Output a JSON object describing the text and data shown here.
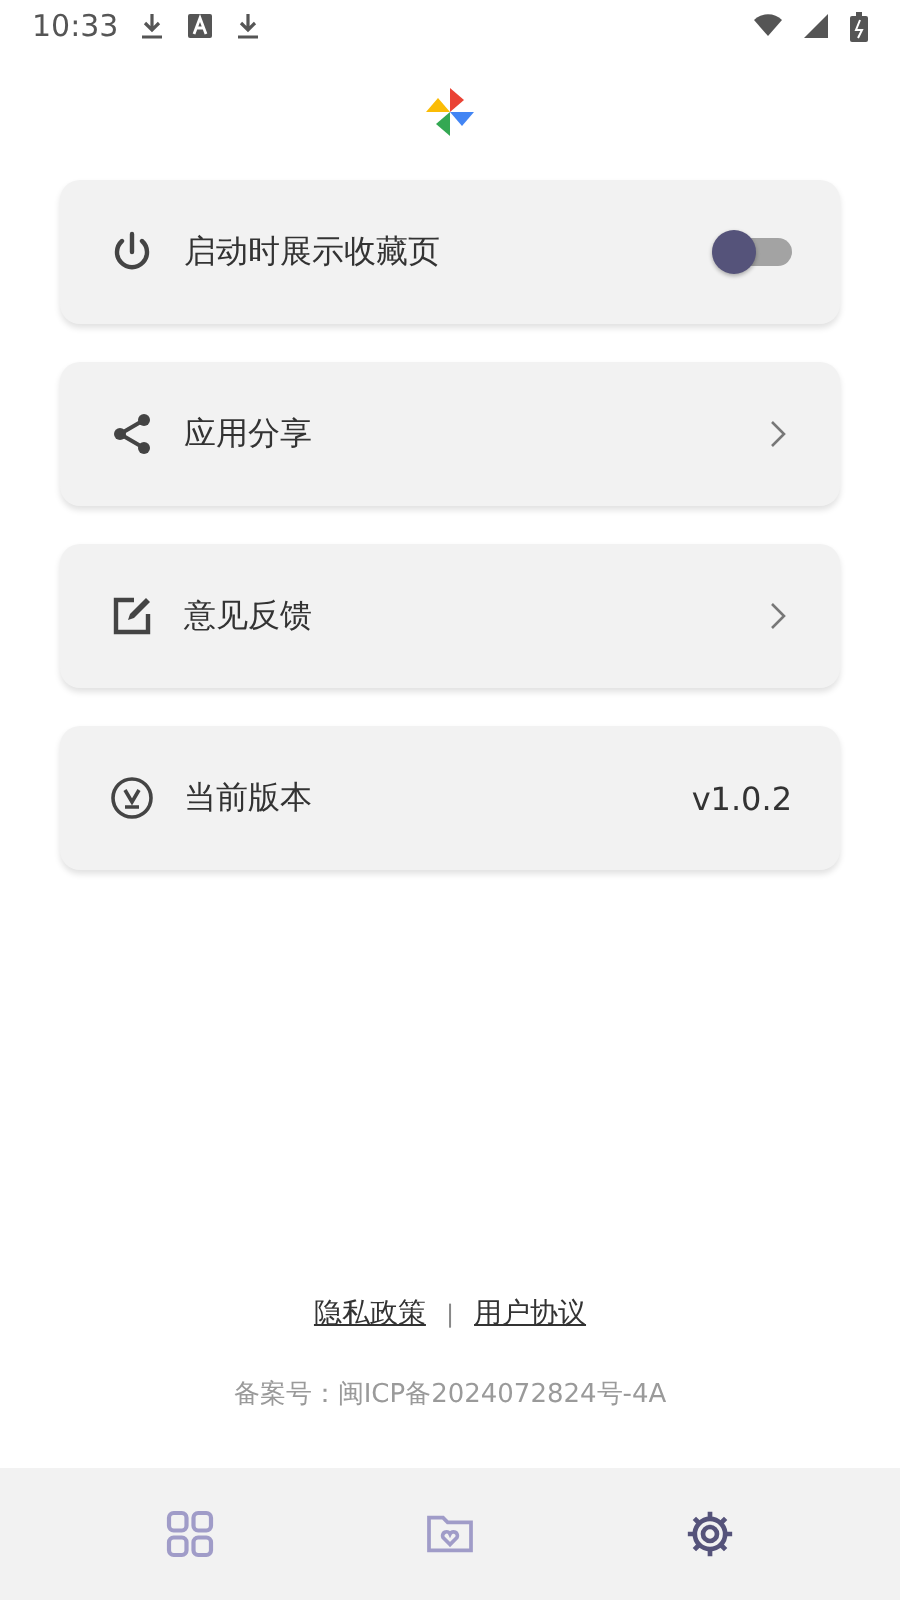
{
  "status_bar": {
    "time": "10:33"
  },
  "settings": [
    {
      "kind": "toggle",
      "label": "启动时展示收藏页",
      "on": false
    },
    {
      "kind": "link",
      "label": "应用分享"
    },
    {
      "kind": "link",
      "label": "意见反馈"
    },
    {
      "kind": "value",
      "label": "当前版本",
      "value": "v1.0.2"
    }
  ],
  "footer": {
    "links": [
      "隐私政策",
      "用户协议"
    ],
    "separator": "|",
    "record": "备案号：闽ICP备2024072824号-4A"
  },
  "bottom_nav": [
    {
      "selected": false
    },
    {
      "selected": false
    },
    {
      "selected": true
    }
  ]
}
